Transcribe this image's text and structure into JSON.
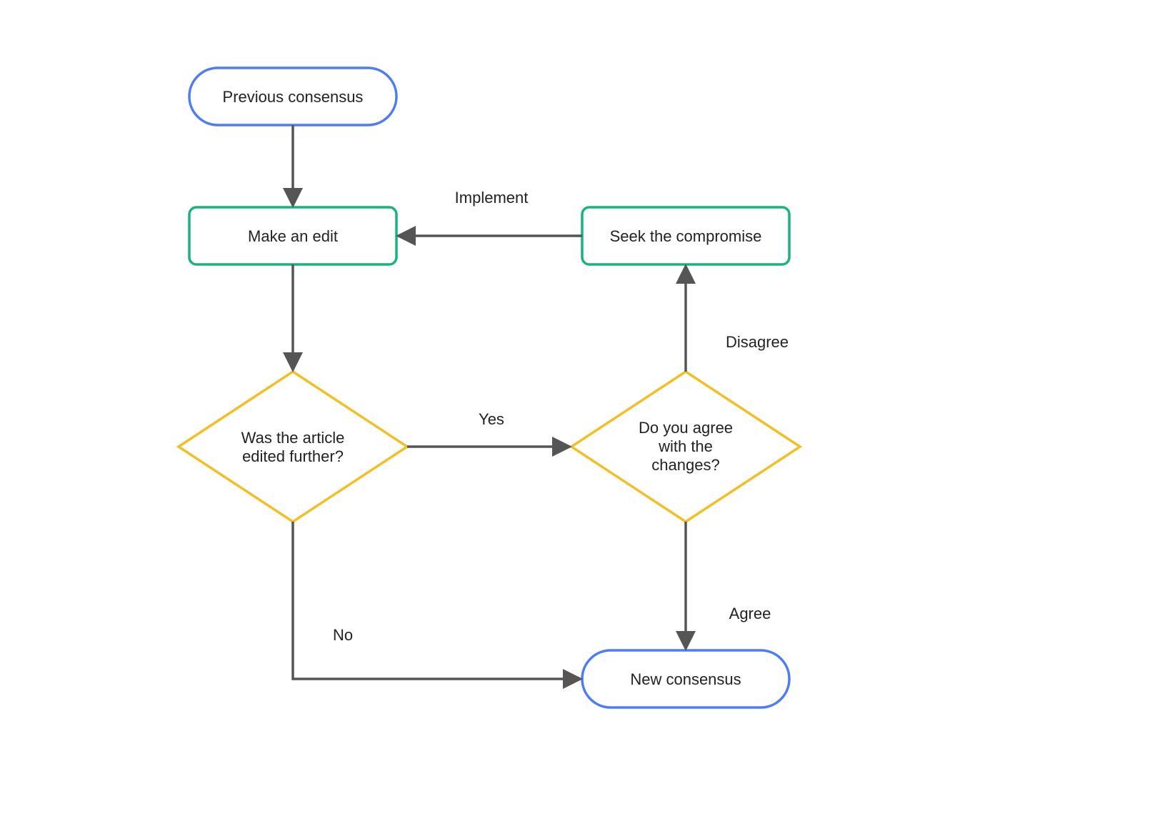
{
  "nodes": {
    "prev": {
      "label": "Previous consensus"
    },
    "edit": {
      "label": "Make an edit"
    },
    "seek": {
      "label": "Seek the compromise"
    },
    "q1_l1": "Was the article",
    "q1_l2": "edited further?",
    "q2_l1": "Do you agree",
    "q2_l2": "with the",
    "q2_l3": "changes?",
    "new": {
      "label": "New consensus"
    }
  },
  "edges": {
    "implement": "Implement",
    "yes": "Yes",
    "no": "No",
    "disagree": "Disagree",
    "agree": "Agree"
  },
  "colors": {
    "blue": "#4E7CF6",
    "green": "#18B47B",
    "yellow": "#F3BF26",
    "arrow": "#555555"
  }
}
